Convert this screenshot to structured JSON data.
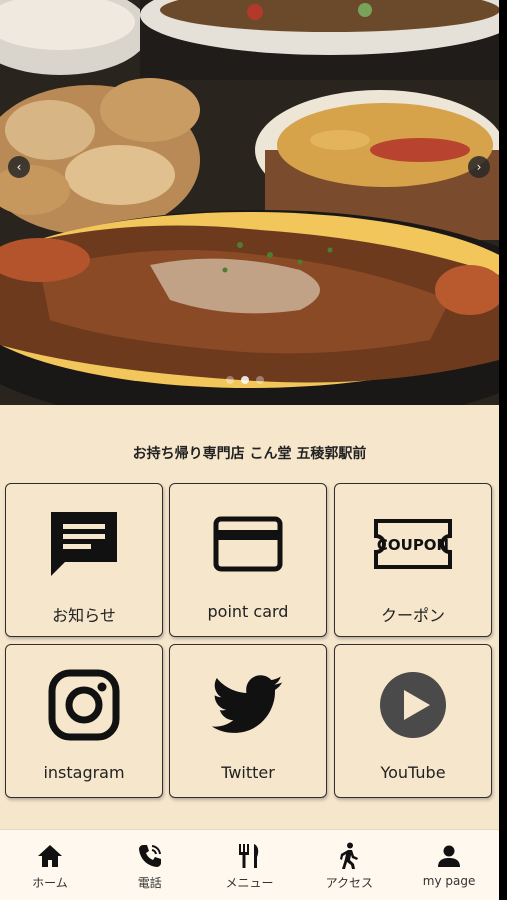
{
  "hero": {
    "prev_label": "‹",
    "next_label": "›",
    "slides": 3,
    "active_slide": 1
  },
  "shop": {
    "name": "お持ち帰り専門店 こん堂 五稜郭駅前"
  },
  "tiles": [
    {
      "label": "お知らせ",
      "icon": "news-icon"
    },
    {
      "label": "point card",
      "icon": "point-card-icon"
    },
    {
      "label": "クーポン",
      "icon": "coupon-icon",
      "icon_text": "COUPON"
    },
    {
      "label": "instagram",
      "icon": "instagram-icon"
    },
    {
      "label": "Twitter",
      "icon": "twitter-icon"
    },
    {
      "label": "YouTube",
      "icon": "youtube-icon"
    }
  ],
  "nav": [
    {
      "label": "ホーム",
      "icon": "home-icon"
    },
    {
      "label": "電話",
      "icon": "phone-icon"
    },
    {
      "label": "メニュー",
      "icon": "menu-utensils-icon"
    },
    {
      "label": "アクセス",
      "icon": "walking-icon"
    },
    {
      "label": "my page",
      "icon": "user-icon"
    }
  ],
  "colors": {
    "background": "#f5e6cc",
    "tile_border": "#2f2f2f",
    "icon": "#111111",
    "nav_background": "#fff8ee"
  }
}
